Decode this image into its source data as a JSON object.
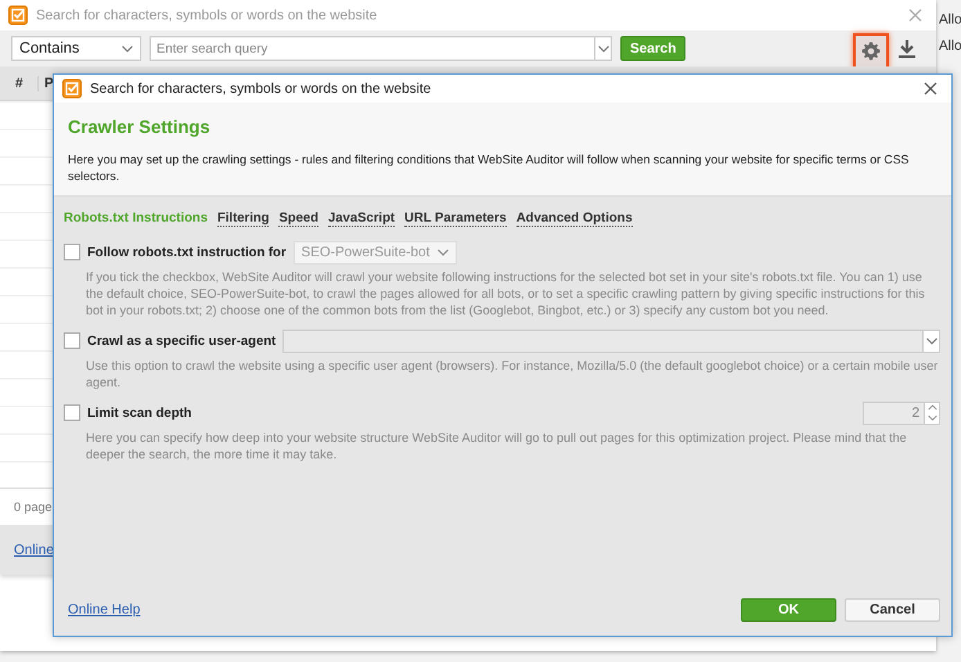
{
  "back_window": {
    "title": "Search for characters, symbols or words on the website",
    "match_mode": "Contains",
    "search_placeholder": "Enter search query",
    "search_button": "Search",
    "settings_highlighted": true,
    "table_columns": [
      "#",
      "P"
    ],
    "status": "0 page",
    "help_link": "Online"
  },
  "side_texts": [
    "Allo",
    "Allo"
  ],
  "dialog": {
    "title": "Search for characters, symbols or words on the website",
    "heading": "Crawler Settings",
    "intro": "Here you may set up the crawling settings - rules and filtering conditions that WebSite Auditor will follow when scanning your website for specific terms or CSS selectors.",
    "tabs": [
      {
        "label": "Robots.txt Instructions",
        "selected": true
      },
      {
        "label": "Filtering",
        "selected": false
      },
      {
        "label": "Speed",
        "selected": false
      },
      {
        "label": "JavaScript",
        "selected": false
      },
      {
        "label": "URL Parameters",
        "selected": false
      },
      {
        "label": "Advanced Options",
        "selected": false
      }
    ],
    "options": [
      {
        "kind": "dropdown",
        "label": "Follow robots.txt instruction for",
        "checked": false,
        "value": "SEO-PowerSuite-bot",
        "description": "If you tick the checkbox, WebSite Auditor will crawl your website following instructions for the selected bot set in your site's robots.txt file. You can 1) use the default choice, SEO-PowerSuite-bot, to crawl the pages allowed for all bots, or to set a specific crawling pattern by giving specific instructions for this bot in your robots.txt; 2) choose one of the common bots from the list (Googlebot, Bingbot, etc.) or 3) specify any custom bot you need."
      },
      {
        "kind": "combo",
        "label": "Crawl as a specific user-agent",
        "checked": false,
        "description": "Use this option to crawl the website using a specific user agent (browsers). For instance, Mozilla/5.0 (the default googlebot choice) or a certain mobile user agent."
      },
      {
        "kind": "spinner",
        "label": "Limit scan depth",
        "checked": false,
        "value": "2",
        "description": "Here you can specify how deep into  your website structure WebSite Auditor will go to pull out pages for this optimization project. Please mind that the deeper the search, the more time it may take."
      }
    ],
    "help_link": "Online Help",
    "buttons": [
      {
        "label": "OK",
        "kind": "primary"
      },
      {
        "label": "Cancel",
        "kind": "secondary"
      }
    ]
  }
}
